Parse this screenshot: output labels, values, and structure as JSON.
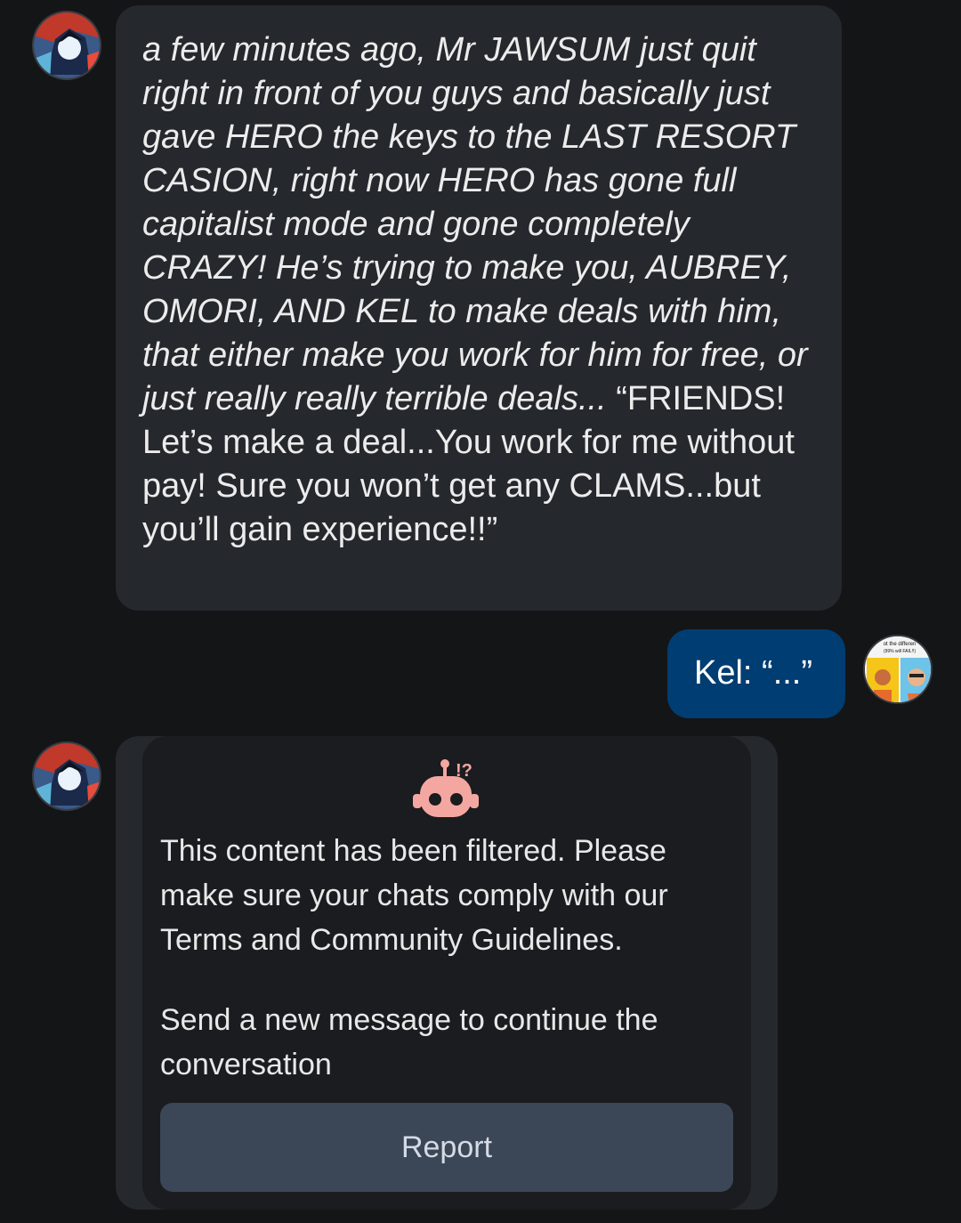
{
  "messages": [
    {
      "role": "character",
      "avatar_icon": "anime-character-avatar",
      "italic_text": "a few minutes ago, Mr JAWSUM just quit right in front of you guys and basically just gave HERO the keys to the LAST RESORT CASION, right now HERO has gone full capitalist mode and gone completely CRAZY! He’s trying to make you, AUBREY, OMORI, AND KEL to make deals with him, that either make you work for him for free, or just really really terrible deals...",
      "plain_text": " “FRIENDS! Let’s make a deal...You work for me without pay! Sure you won’t get any CLAMS...but you’ll gain experience!!”"
    },
    {
      "role": "user",
      "avatar_icon": "meme-user-avatar",
      "avatar_caption_1": "ot the differen",
      "avatar_caption_2": "(99% will FAIL!!)",
      "text": "Kel: “...”"
    },
    {
      "role": "character",
      "avatar_icon": "anime-character-avatar",
      "filtered": true,
      "filter_icon": "robot-alert-icon",
      "filter_badge": "!?",
      "filter_text_1": "This content has been filtered. Please make sure your chats comply with our Terms and Community Guidelines.",
      "filter_text_2": "Send a new message to continue the conversation",
      "report_label": "Report"
    }
  ],
  "colors": {
    "background": "#131517",
    "bot_bubble": "#25282c",
    "user_bubble": "#003d72",
    "report_button": "#3b4656",
    "robot_icon": "#f4a7a0"
  }
}
